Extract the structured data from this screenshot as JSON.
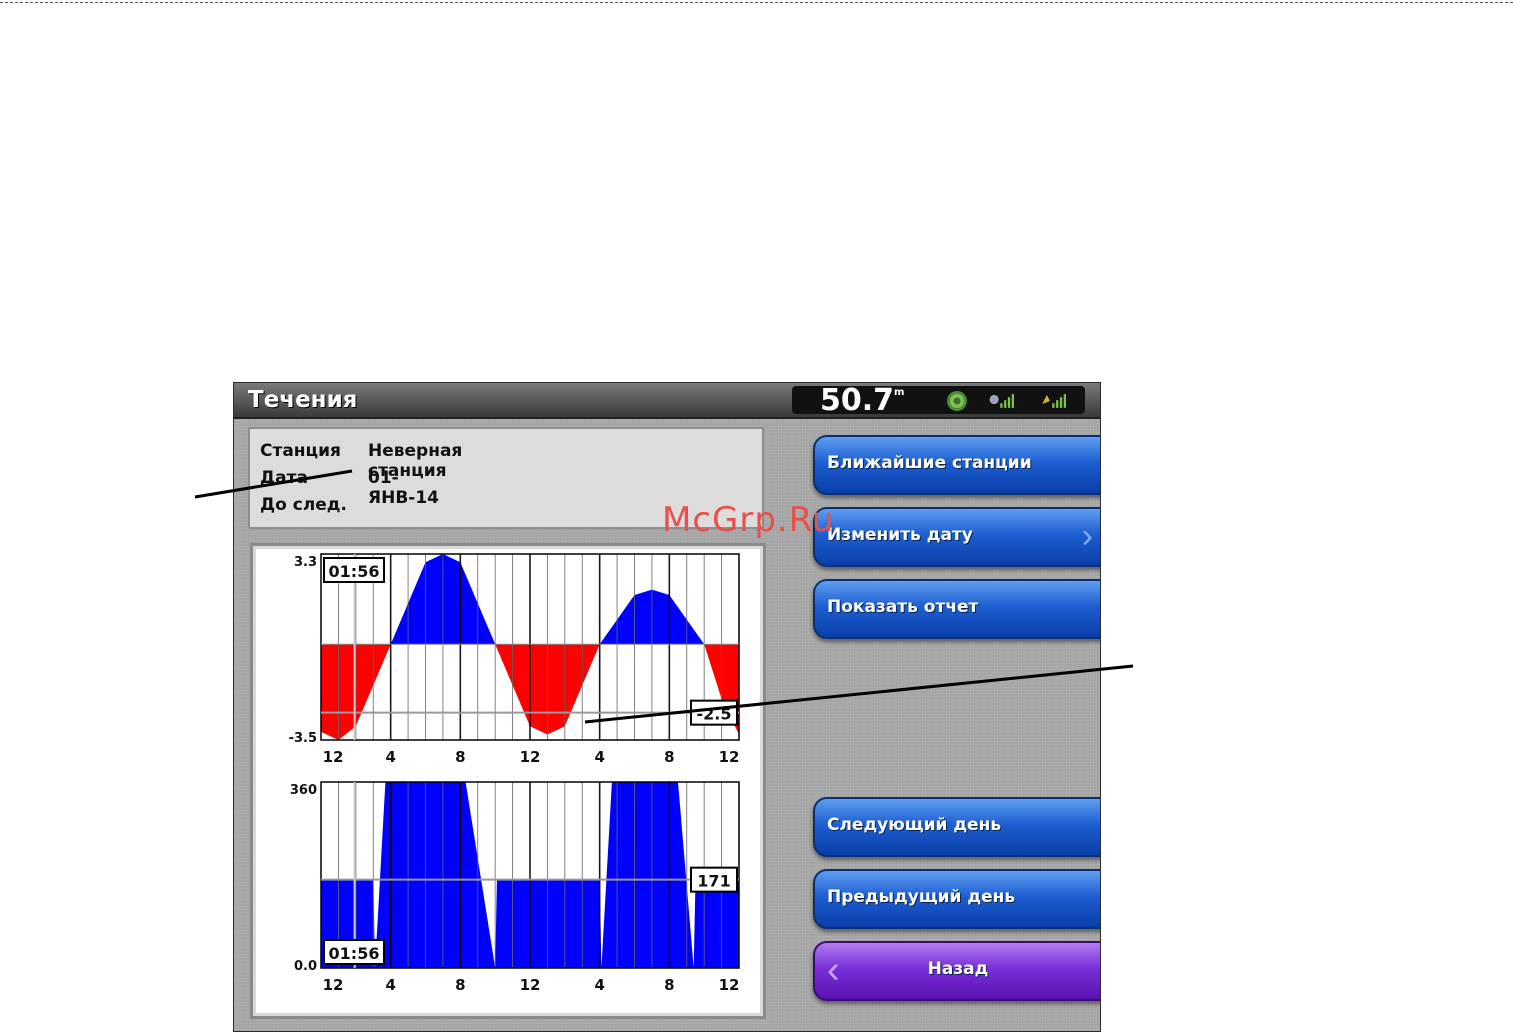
{
  "window": {
    "title": "Течения"
  },
  "status": {
    "speed_value": "50.7",
    "speed_unit": "m",
    "icons": [
      "sonar-icon",
      "satellite-signal-icon",
      "gps-signal-icon"
    ]
  },
  "info": {
    "station_label": "Станция",
    "station_value": "Неверная станция",
    "date_label": "Дата",
    "date_value": "01-ЯНВ-14",
    "next_label": "До след."
  },
  "buttons": {
    "nearest": "Ближайшие станции",
    "change_date": "Изменить дату",
    "show_report": "Показать отчет",
    "next_day": "Следующий день",
    "prev_day": "Предыдущий день",
    "back": "Назад"
  },
  "watermark": "McGrp.Ru",
  "colors": {
    "flood": "#0000ff",
    "ebb": "#ff0000",
    "button_blue": "#1e5fd2",
    "button_purple": "#7a2fd8"
  },
  "chart_data": [
    {
      "type": "area",
      "ylim": [
        -3.5,
        3.3
      ],
      "y_top_label": "3.3",
      "y_bottom_label": "-3.5",
      "x_ticks": [
        "12",
        "4",
        "8",
        "12",
        "4",
        "8",
        "12"
      ],
      "x_hours": [
        0,
        4,
        8,
        12,
        16,
        20,
        24
      ],
      "series": [
        {
          "x": [
            0,
            1,
            2,
            4,
            6,
            7,
            8,
            10,
            12,
            13,
            14,
            16,
            18,
            19,
            20,
            22,
            23,
            24
          ],
          "values": [
            -3.2,
            -3.5,
            -3.0,
            0.0,
            3.0,
            3.3,
            3.0,
            0.0,
            -3.0,
            -3.3,
            -3.0,
            0.0,
            1.8,
            2.0,
            1.8,
            0.0,
            -2.0,
            -3.3
          ]
        }
      ],
      "cursor_time": "01:56",
      "cursor_value": "-2.5"
    },
    {
      "type": "area",
      "ylim": [
        0,
        360
      ],
      "y_top_label": "360",
      "y_bottom_label": "0.0",
      "x_ticks": [
        "12",
        "4",
        "8",
        "12",
        "4",
        "8",
        "12"
      ],
      "x_hours": [
        0,
        4,
        8,
        12,
        16,
        20,
        24
      ],
      "series": [
        {
          "x": [
            0,
            3.0,
            3.1,
            3.7,
            8.3,
            10.0,
            10.1,
            16.0,
            16.1,
            16.7,
            20.5,
            21.4,
            21.5,
            24
          ],
          "values": [
            171,
            171,
            0,
            360,
            360,
            0,
            171,
            171,
            0,
            360,
            360,
            0,
            171,
            171
          ]
        }
      ],
      "cursor_time": "01:56",
      "cursor_value": "171"
    }
  ]
}
